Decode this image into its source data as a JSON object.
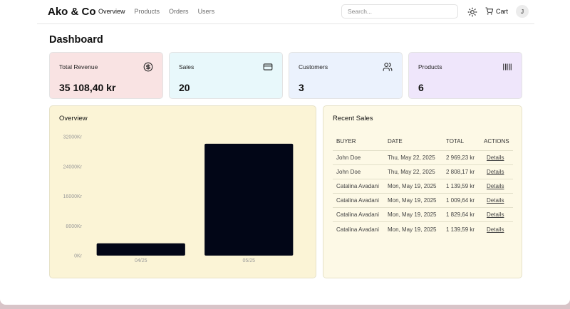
{
  "header": {
    "brand": "Ako & Co",
    "nav": [
      "Overview",
      "Products",
      "Orders",
      "Users"
    ],
    "search_placeholder": "Search...",
    "cart_label": "Cart",
    "avatar_initial": "J"
  },
  "page_title": "Dashboard",
  "stats": [
    {
      "label": "Total Revenue",
      "value": "35 108,40 kr",
      "icon": "dollar-circle-icon",
      "bg": "#f9e3e3"
    },
    {
      "label": "Sales",
      "value": "20",
      "icon": "credit-card-icon",
      "bg": "#e8f8fb"
    },
    {
      "label": "Customers",
      "value": "3",
      "icon": "users-icon",
      "bg": "#ebf2fd"
    },
    {
      "label": "Products",
      "value": "6",
      "icon": "barcode-icon",
      "bg": "#efe6fb"
    }
  ],
  "overview": {
    "title": "Overview",
    "bg": "#fbf4d6",
    "bar_color": "#020617",
    "chart_data": {
      "type": "bar",
      "categories": [
        "04/25",
        "05/25"
      ],
      "values": [
        3300,
        30100
      ],
      "ylim": [
        0,
        32000
      ],
      "yticks": [
        "0Kr",
        "8000Kr",
        "16000Kr",
        "24000Kr",
        "32000Kr"
      ],
      "grid": false
    }
  },
  "recent_sales": {
    "title": "Recent Sales",
    "bg": "#fdf9e6",
    "columns": [
      "BUYER",
      "DATE",
      "TOTAL",
      "ACTIONS"
    ],
    "rows": [
      {
        "buyer": "John Doe",
        "date": "Thu, May 22, 2025",
        "total": "2 969,23 kr",
        "action": "Details"
      },
      {
        "buyer": "John Doe",
        "date": "Thu, May 22, 2025",
        "total": "2 808,17 kr",
        "action": "Details"
      },
      {
        "buyer": "Catalina Avadani",
        "date": "Mon, May 19, 2025",
        "total": "1 139,59 kr",
        "action": "Details"
      },
      {
        "buyer": "Catalina Avadani",
        "date": "Mon, May 19, 2025",
        "total": "1 009,64 kr",
        "action": "Details"
      },
      {
        "buyer": "Catalina Avadani",
        "date": "Mon, May 19, 2025",
        "total": "1 829,64 kr",
        "action": "Details"
      },
      {
        "buyer": "Catalina Avadani",
        "date": "Mon, May 19, 2025",
        "total": "1 139,59 kr",
        "action": "Details"
      }
    ]
  }
}
